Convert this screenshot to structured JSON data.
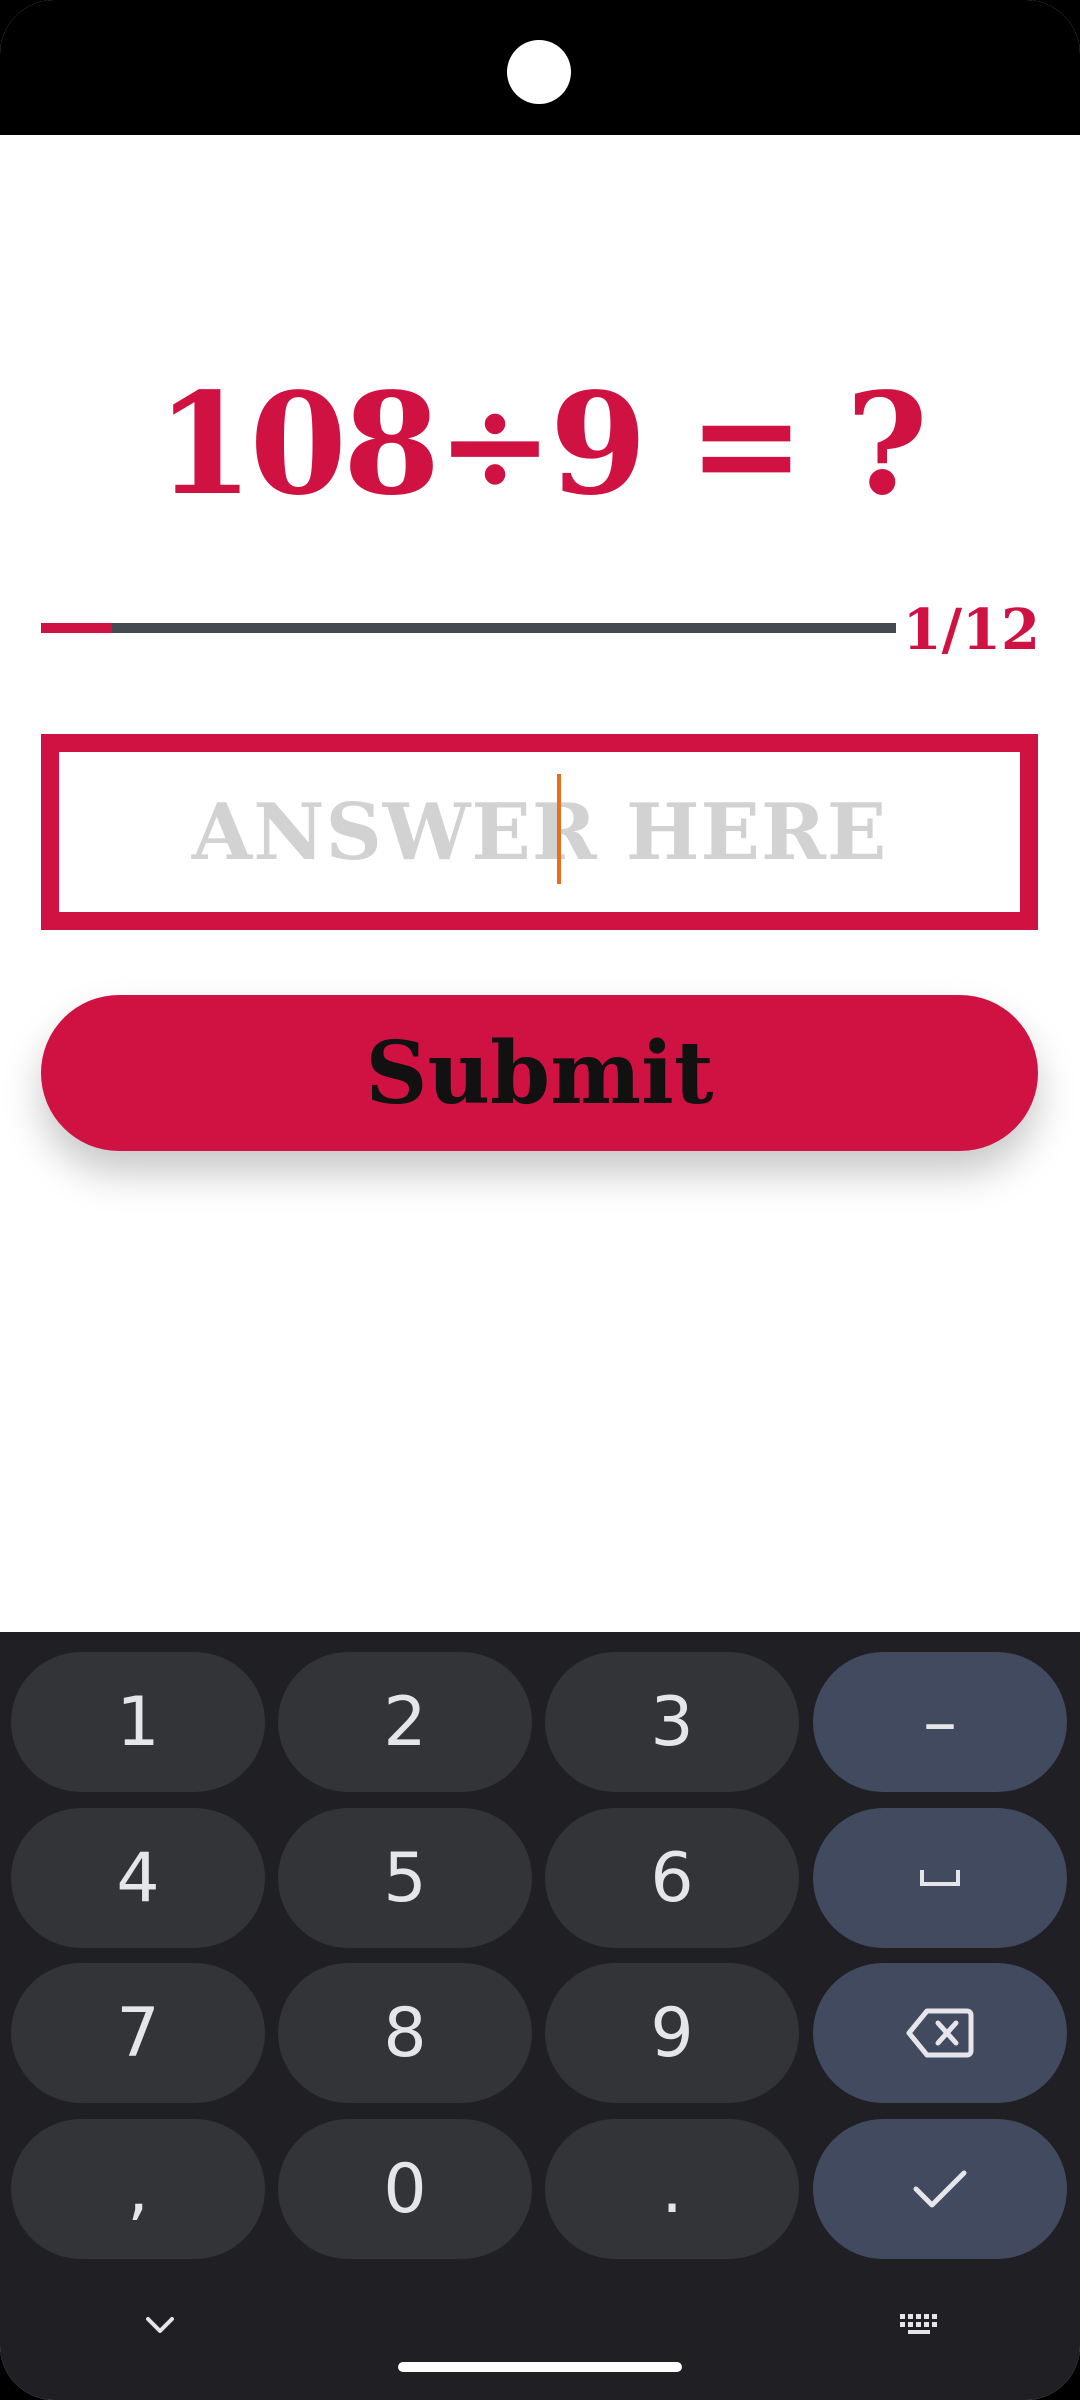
{
  "question": {
    "text": "108÷9 = ?"
  },
  "progress": {
    "label": "1/12",
    "current": 1,
    "total": 12,
    "fraction": 0.0833
  },
  "answer": {
    "placeholder": "ANSWER HERE",
    "value": ""
  },
  "submit": {
    "label": "Submit"
  },
  "keyboard": {
    "keys": [
      {
        "label": "1",
        "type": "digit"
      },
      {
        "label": "2",
        "type": "digit"
      },
      {
        "label": "3",
        "type": "digit"
      },
      {
        "label": "–",
        "type": "function"
      },
      {
        "label": "4",
        "type": "digit"
      },
      {
        "label": "5",
        "type": "digit"
      },
      {
        "label": "6",
        "type": "digit"
      },
      {
        "label": "␣",
        "type": "function",
        "icon": "space-icon"
      },
      {
        "label": "7",
        "type": "digit"
      },
      {
        "label": "8",
        "type": "digit"
      },
      {
        "label": "9",
        "type": "digit"
      },
      {
        "label": "⌫",
        "type": "function",
        "icon": "backspace-icon"
      },
      {
        "label": ",",
        "type": "digit"
      },
      {
        "label": "0",
        "type": "digit"
      },
      {
        "label": ".",
        "type": "digit"
      },
      {
        "label": "✓",
        "type": "function",
        "icon": "checkmark-icon"
      }
    ],
    "bottom_icons": [
      "chevron-down-icon",
      "keyboard-switch-icon"
    ]
  },
  "colors": {
    "accent": "#d01242",
    "progress_track": "#434a50",
    "placeholder": "#d2d2d2",
    "cursor": "#e4701e",
    "keyboard_bg": "#1f1f24",
    "key_bg": "#333438",
    "function_key_bg": "#414a5e"
  }
}
